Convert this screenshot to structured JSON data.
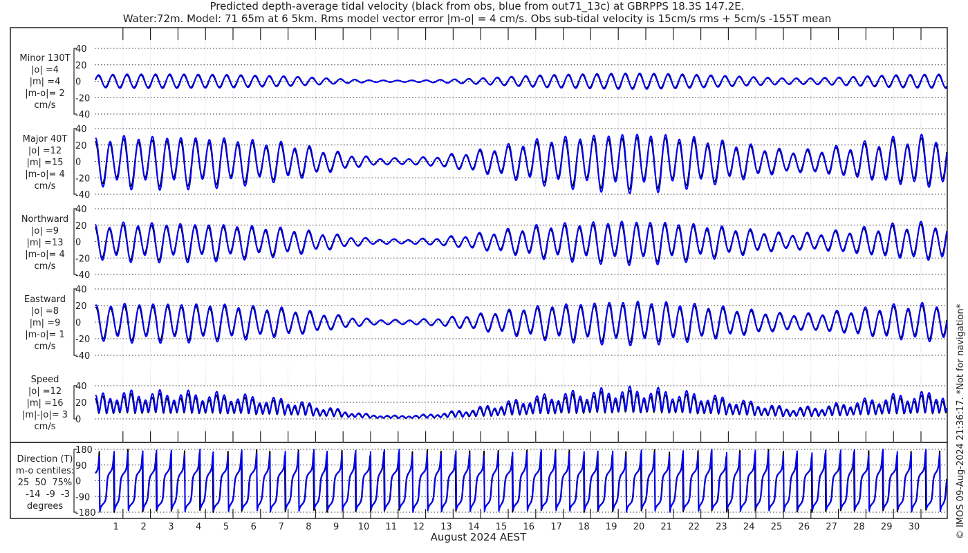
{
  "title": [
    "Predicted depth-average tidal velocity (black from obs, blue from out71_13c) at GBRPPS 18.3S 147.2E.",
    "Water:72m. Model: 71 65m at 6 5km. Rms model vector error |m-o| = 4 cm/s. Obs sub-tidal velocity is 15cm/s rms + 5cm/s -155T mean"
  ],
  "copyright": "© IMOS 09-Aug-2024 21:36:17. *Not for navigation*",
  "chart_data": {
    "type": "line",
    "xlabel": "August 2024 AEST",
    "x_ticks": [
      "1",
      "2",
      "3",
      "4",
      "5",
      "6",
      "7",
      "8",
      "9",
      "10",
      "11",
      "12",
      "13",
      "14",
      "15",
      "16",
      "17",
      "18",
      "19",
      "20",
      "21",
      "22",
      "23",
      "24",
      "25",
      "26",
      "27",
      "28",
      "29",
      "30"
    ],
    "xlim_days": [
      0,
      30.95
    ],
    "series_colors": {
      "obs": "#000000",
      "model": "#0000ff"
    },
    "grid": true,
    "semidiurnal_period_days": 0.5175,
    "major_axis_T": 40,
    "minor_axis_T": 130,
    "model_gain": 1.15,
    "tidal_envelope_cm_s": [
      22,
      25,
      25,
      25,
      24,
      23,
      20,
      18,
      13,
      8,
      4,
      3,
      4,
      7,
      11,
      16,
      21,
      24,
      26,
      28,
      28,
      26,
      23,
      19,
      15,
      11,
      11,
      14,
      18,
      22,
      24,
      25
    ],
    "panels": [
      {
        "key": "minor",
        "label_lines": [
          "Minor 130T",
          "|o| =4",
          "|m| =4",
          "|m-o|= 2",
          "cm/s"
        ],
        "yticks": [
          "40",
          "20",
          "0",
          "-20",
          "-40"
        ],
        "ylim": [
          -40,
          40
        ]
      },
      {
        "key": "major",
        "label_lines": [
          "Major 40T",
          "|o| =12",
          "|m| =15",
          "|m-o|= 4",
          "cm/s"
        ],
        "yticks": [
          "40",
          "20",
          "0",
          "-20",
          "-40"
        ],
        "ylim": [
          -40,
          40
        ]
      },
      {
        "key": "north",
        "label_lines": [
          "Northward",
          "|o| =9",
          "|m| =13",
          "|m-o|= 4",
          "cm/s"
        ],
        "yticks": [
          "40",
          "20",
          "0",
          "-20",
          "-40"
        ],
        "ylim": [
          -40,
          40
        ]
      },
      {
        "key": "east",
        "label_lines": [
          "Eastward",
          "|o| =8",
          "|m| =9",
          "|m-o|= 1",
          "cm/s"
        ],
        "yticks": [
          "40",
          "20",
          "0",
          "-20",
          "-40"
        ],
        "ylim": [
          -40,
          40
        ]
      },
      {
        "key": "speed",
        "label_lines": [
          "Speed",
          "|o| =12",
          "|m| =16",
          "|m|-|o|= 3",
          "cm/s"
        ],
        "yticks": [
          "40",
          "20",
          "0"
        ],
        "ylim": [
          0,
          40
        ]
      },
      {
        "key": "direction",
        "label_lines": [
          "Direction (T)",
          "m-o centiles:",
          "25  50  75%",
          "  -14  -9  -3",
          "degrees"
        ],
        "yticks": [
          "180",
          "90",
          "0",
          "-90",
          "-180"
        ],
        "ylim": [
          -180,
          180
        ]
      }
    ]
  }
}
